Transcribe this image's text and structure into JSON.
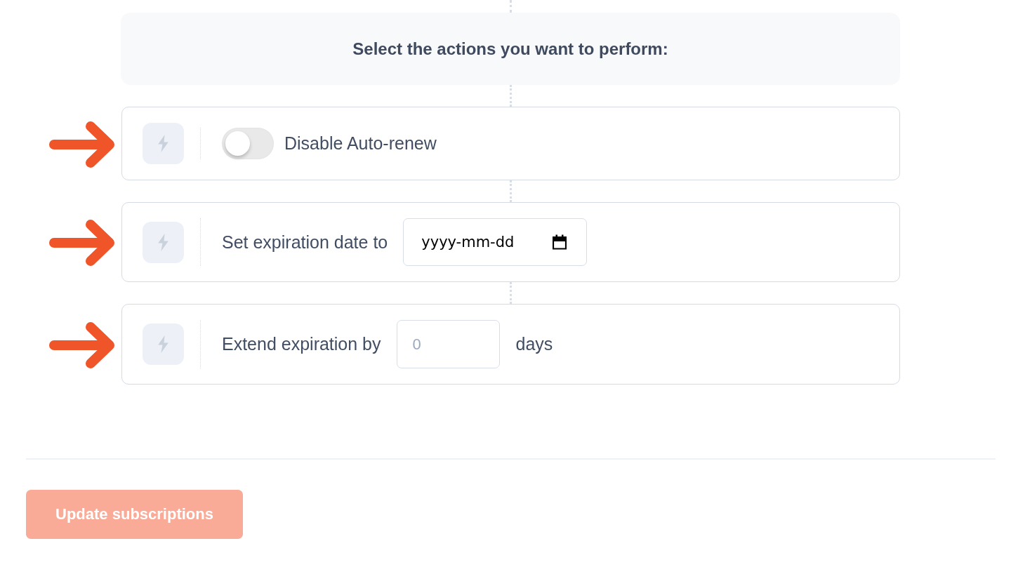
{
  "header": {
    "title": "Select the actions you want to perform:"
  },
  "actions": [
    {
      "kind": "toggle",
      "label": "Disable Auto-renew",
      "on": false
    },
    {
      "kind": "date",
      "label": "Set expiration date to",
      "placeholder": "yyyy-mm-dd"
    },
    {
      "kind": "number",
      "label": "Extend expiration by",
      "placeholder": "0",
      "suffix": "days"
    }
  ],
  "submit": {
    "label": "Update subscriptions",
    "disabled": true
  }
}
